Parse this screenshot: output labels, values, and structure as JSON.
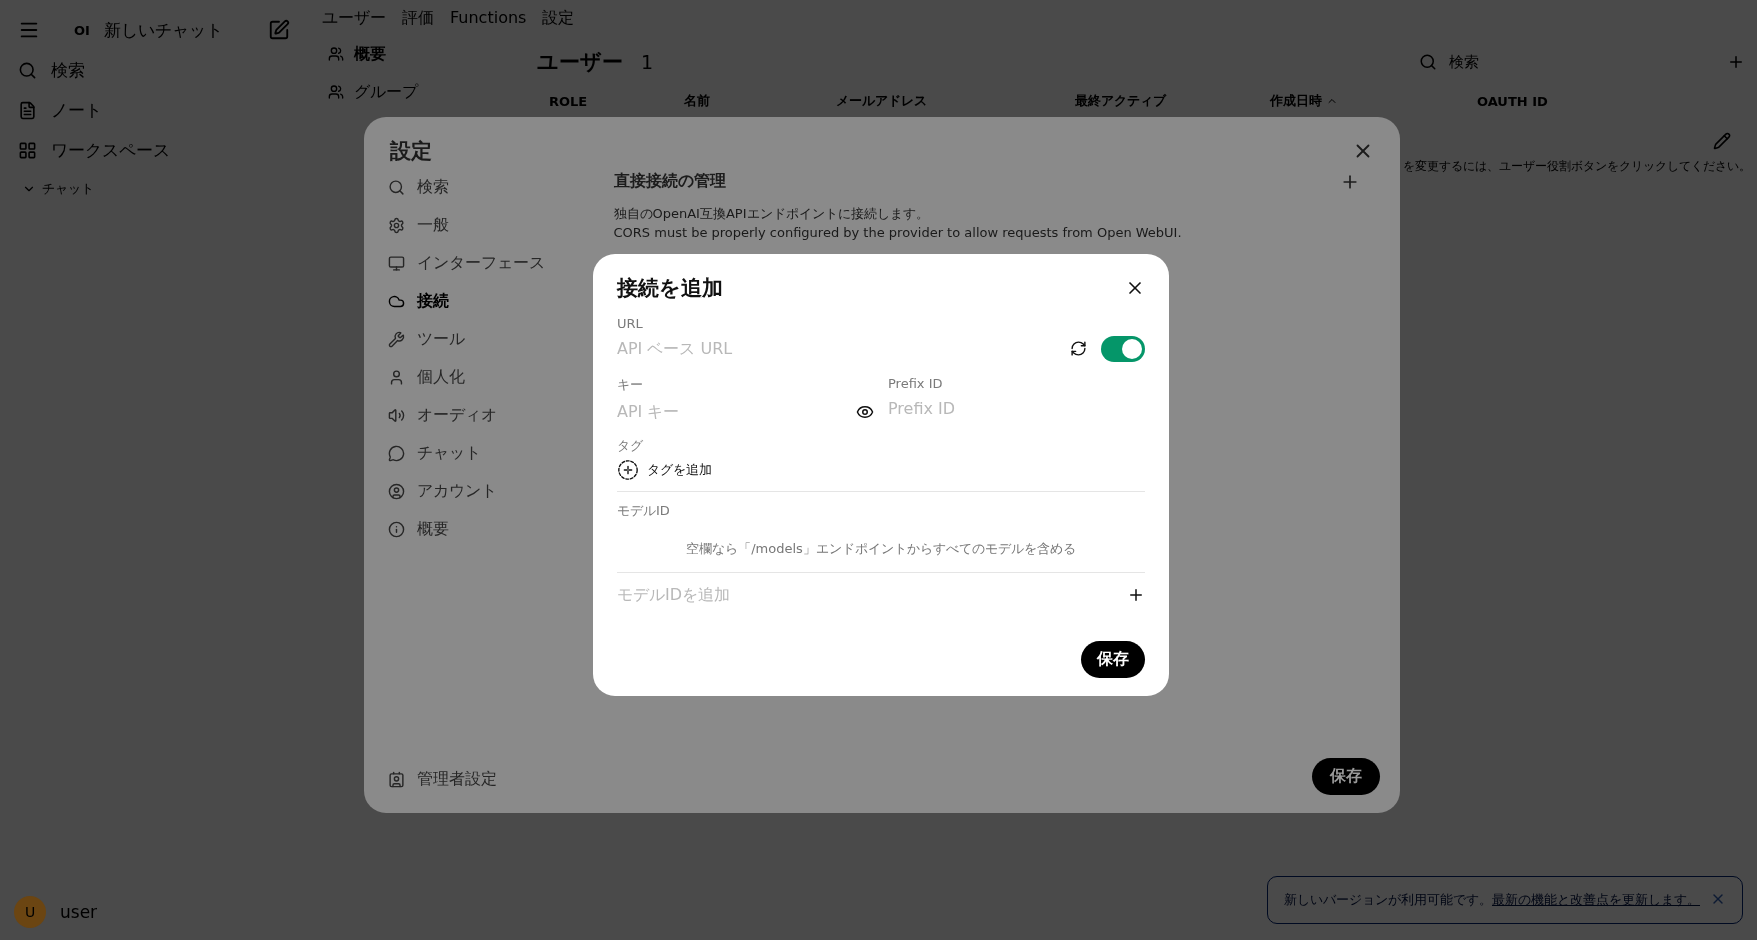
{
  "sidebar": {
    "logo": "OI",
    "title": "新しいチャット",
    "items": [
      {
        "label": "検索"
      },
      {
        "label": "ノート"
      },
      {
        "label": "ワークスペース"
      }
    ],
    "section": {
      "label": "チャット",
      "expanded": true
    },
    "user": {
      "initial": "U",
      "name": "user"
    }
  },
  "admin": {
    "tabs": [
      {
        "label": "ユーザー"
      },
      {
        "label": "評価"
      },
      {
        "label": "Functions"
      },
      {
        "label": "設定"
      }
    ],
    "subnav": [
      {
        "label": "概要",
        "selected": true
      },
      {
        "label": "グループ",
        "selected": false
      }
    ],
    "users": {
      "title": "ユーザー",
      "count": "1",
      "search_placeholder": "検索",
      "columns": [
        {
          "label": "ROLE",
          "sorted": false
        },
        {
          "label": "名前",
          "sorted": false
        },
        {
          "label": "メールアドレス",
          "sorted": false
        },
        {
          "label": "最終アクティブ",
          "sorted": false
        },
        {
          "label": "作成日時",
          "sorted": true
        },
        {
          "label": "OAUTH ID",
          "sorted": false
        }
      ],
      "hint": "を変更するには、ユーザー役割ボタンをクリックしてください。"
    }
  },
  "settings": {
    "title": "設定",
    "nav": [
      {
        "label": "検索",
        "selected": false
      },
      {
        "label": "一般",
        "selected": false
      },
      {
        "label": "インターフェース",
        "selected": false
      },
      {
        "label": "接続",
        "selected": true
      },
      {
        "label": "ツール",
        "selected": false
      },
      {
        "label": "個人化",
        "selected": false
      },
      {
        "label": "オーディオ",
        "selected": false
      },
      {
        "label": "チャット",
        "selected": false
      },
      {
        "label": "アカウント",
        "selected": false
      },
      {
        "label": "概要",
        "selected": false
      }
    ],
    "admin_settings": "管理者設定",
    "section": {
      "title": "直接接続の管理",
      "description": "独自のOpenAI互換APIエンドポイントに接続します。",
      "note": "CORS must be properly configured by the provider to allow requests from Open WebUI."
    },
    "save": "保存"
  },
  "dialog": {
    "title": "接続を追加",
    "url": {
      "label": "URL",
      "placeholder": "API ベース URL",
      "enabled": true
    },
    "key": {
      "label": "キー",
      "placeholder": "API キー"
    },
    "prefix": {
      "label": "Prefix ID",
      "placeholder": "Prefix ID"
    },
    "tags": {
      "label": "タグ",
      "add": "タグを追加"
    },
    "models": {
      "label": "モデルID",
      "empty": "空欄なら「/models」エンドポイントからすべてのモデルを含める",
      "placeholder": "モデルIDを追加"
    },
    "save": "保存"
  },
  "toast": {
    "text": "新しいバージョンが利用可能です。",
    "link": "最新の機能と改善点を更新します。"
  }
}
